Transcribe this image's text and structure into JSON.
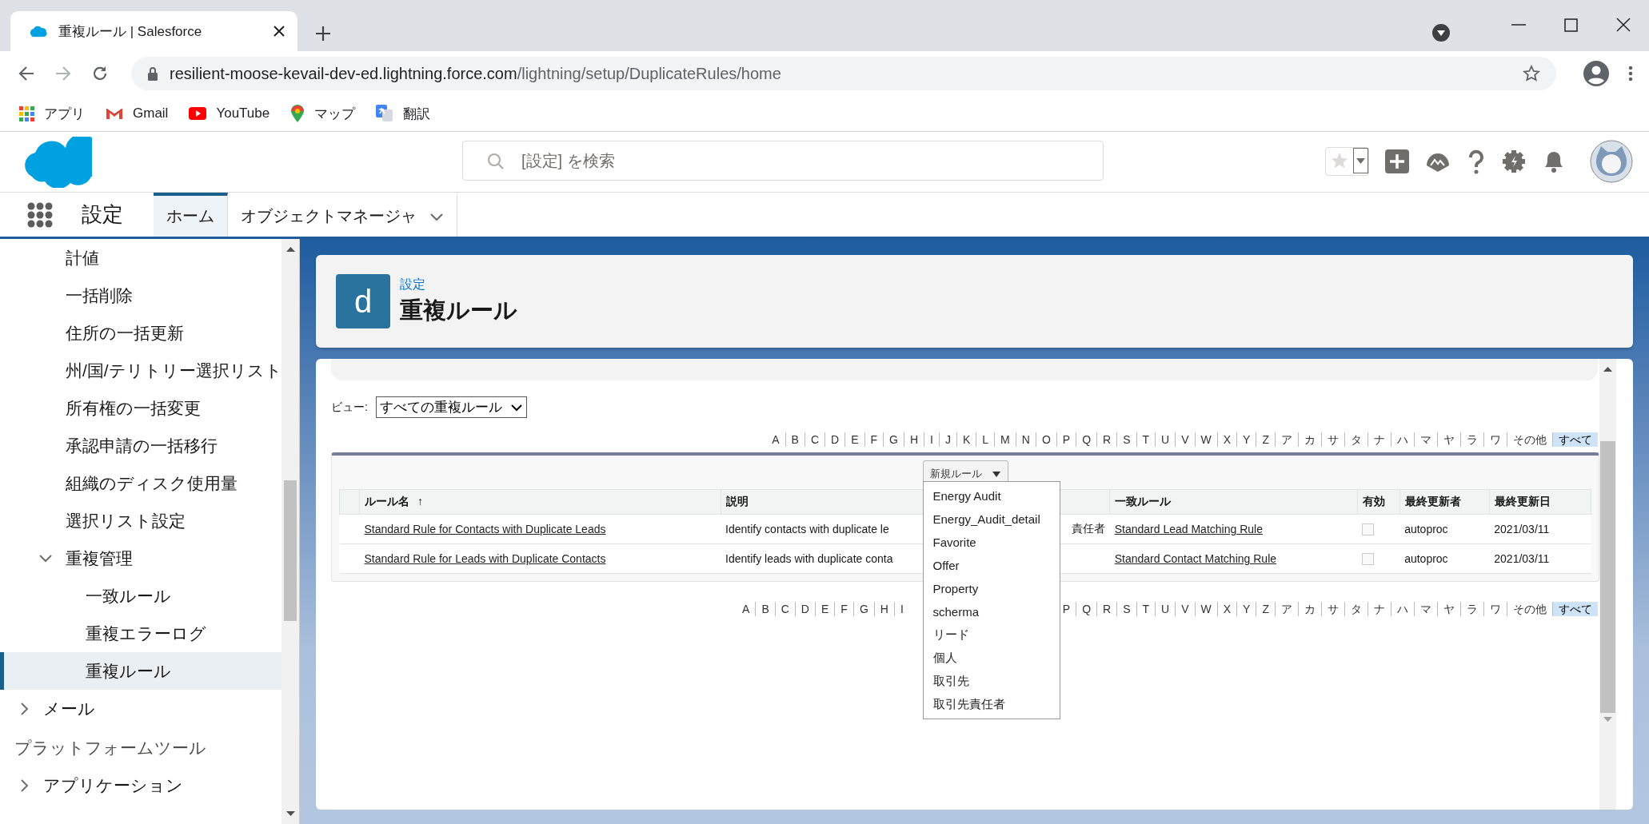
{
  "browser": {
    "tab_title": "重複ルール | Salesforce",
    "url_host": "resilient-moose-kevail-dev-ed.lightning.force.com",
    "url_path": "/lightning/setup/DuplicateRules/home",
    "bookmarks": [
      {
        "kind": "apps",
        "label": "アプリ"
      },
      {
        "kind": "gmail",
        "label": "Gmail"
      },
      {
        "kind": "youtube",
        "label": "YouTube"
      },
      {
        "kind": "maps",
        "label": "マップ"
      },
      {
        "kind": "translate",
        "label": "翻訳"
      }
    ]
  },
  "header": {
    "search_placeholder": "[設定] を検索"
  },
  "nav": {
    "app_name": "設定",
    "tabs": [
      {
        "label": "ホーム",
        "selected": true
      },
      {
        "label": "オブジェクトマネージャ",
        "selected": false
      }
    ]
  },
  "sidebar": {
    "items": [
      {
        "label": "計値",
        "selected": false
      },
      {
        "label": "一括削除",
        "selected": false
      },
      {
        "label": "住所の一括更新",
        "selected": false
      },
      {
        "label": "州/国/テリトリー選択リスト",
        "selected": false
      },
      {
        "label": "所有権の一括変更",
        "selected": false
      },
      {
        "label": "承認申請の一括移行",
        "selected": false
      },
      {
        "label": "組織のディスク使用量",
        "selected": false
      },
      {
        "label": "選択リスト設定",
        "selected": false
      },
      {
        "label": "重複管理",
        "selected": false,
        "expanded": true,
        "children": [
          {
            "label": "一致ルール",
            "selected": false
          },
          {
            "label": "重複エラーログ",
            "selected": false
          },
          {
            "label": "重複ルール",
            "selected": true
          }
        ]
      }
    ],
    "top_items": [
      {
        "label": "メール",
        "expanded": false
      }
    ],
    "section_title": "プラットフォームツール",
    "section_items": [
      {
        "label": "アプリケーション",
        "expanded": false
      }
    ]
  },
  "page_header": {
    "icon_letter": "d",
    "breadcrumb": "設定",
    "title": "重複ルール"
  },
  "view": {
    "label": "ビュー:",
    "value": "すべての重複ルール"
  },
  "alphabet_top": [
    {
      "label": "A",
      "selected": false
    },
    {
      "label": "B",
      "selected": false
    },
    {
      "label": "C",
      "selected": false
    },
    {
      "label": "D",
      "selected": false
    },
    {
      "label": "E",
      "selected": false
    },
    {
      "label": "F",
      "selected": false
    },
    {
      "label": "G",
      "selected": false
    },
    {
      "label": "H",
      "selected": false
    },
    {
      "label": "I",
      "selected": false
    },
    {
      "label": "J",
      "selected": false
    },
    {
      "label": "K",
      "selected": false
    },
    {
      "label": "L",
      "selected": false
    },
    {
      "label": "M",
      "selected": false
    },
    {
      "label": "N",
      "selected": false
    },
    {
      "label": "O",
      "selected": false
    },
    {
      "label": "P",
      "selected": false
    },
    {
      "label": "Q",
      "selected": false
    },
    {
      "label": "R",
      "selected": false
    },
    {
      "label": "S",
      "selected": false
    },
    {
      "label": "T",
      "selected": false
    },
    {
      "label": "U",
      "selected": false
    },
    {
      "label": "V",
      "selected": false
    },
    {
      "label": "W",
      "selected": false
    },
    {
      "label": "X",
      "selected": false
    },
    {
      "label": "Y",
      "selected": false
    },
    {
      "label": "Z",
      "selected": false
    },
    {
      "label": "ア",
      "selected": false
    },
    {
      "label": "カ",
      "selected": false
    },
    {
      "label": "サ",
      "selected": false
    },
    {
      "label": "タ",
      "selected": false
    },
    {
      "label": "ナ",
      "selected": false
    },
    {
      "label": "ハ",
      "selected": false
    },
    {
      "label": "マ",
      "selected": false
    },
    {
      "label": "ヤ",
      "selected": false
    },
    {
      "label": "ラ",
      "selected": false
    },
    {
      "label": "ワ",
      "selected": false
    },
    {
      "label": "その他",
      "selected": false
    },
    {
      "label": "すべて",
      "selected": true
    }
  ],
  "alphabet_bottom": {
    "before_menu": [
      {
        "label": "A",
        "selected": false
      },
      {
        "label": "B",
        "selected": false
      },
      {
        "label": "C",
        "selected": false
      },
      {
        "label": "D",
        "selected": false
      },
      {
        "label": "E",
        "selected": false
      },
      {
        "label": "F",
        "selected": false
      },
      {
        "label": "G",
        "selected": false
      },
      {
        "label": "H",
        "selected": false
      },
      {
        "label": "I",
        "selected": false
      }
    ],
    "after_menu": [
      {
        "label": "P",
        "selected": false
      },
      {
        "label": "Q",
        "selected": false
      },
      {
        "label": "R",
        "selected": false
      },
      {
        "label": "S",
        "selected": false
      },
      {
        "label": "T",
        "selected": false
      },
      {
        "label": "U",
        "selected": false
      },
      {
        "label": "V",
        "selected": false
      },
      {
        "label": "W",
        "selected": false
      },
      {
        "label": "X",
        "selected": false
      },
      {
        "label": "Y",
        "selected": false
      },
      {
        "label": "Z",
        "selected": false
      },
      {
        "label": "ア",
        "selected": false
      },
      {
        "label": "カ",
        "selected": false
      },
      {
        "label": "サ",
        "selected": false
      },
      {
        "label": "タ",
        "selected": false
      },
      {
        "label": "ナ",
        "selected": false
      },
      {
        "label": "ハ",
        "selected": false
      },
      {
        "label": "マ",
        "selected": false
      },
      {
        "label": "ヤ",
        "selected": false
      },
      {
        "label": "ラ",
        "selected": false
      },
      {
        "label": "ワ",
        "selected": false
      },
      {
        "label": "その他",
        "selected": false
      },
      {
        "label": "すべて",
        "selected": true
      }
    ]
  },
  "table": {
    "new_button": "新規ルール",
    "new_menu": [
      "Energy Audit",
      "Energy_Audit_detail",
      "Favorite",
      "Offer",
      "Property",
      "scherma",
      "リード",
      "個人",
      "取引先",
      "取引先責任者"
    ],
    "columns": [
      {
        "label": "ルール名",
        "sort_icon": "↑"
      },
      {
        "label": "説明"
      },
      {},
      {
        "label": "一致ルール"
      },
      {
        "label": "有効"
      },
      {
        "label": "最終更新者"
      },
      {
        "label": "最終更新日"
      }
    ],
    "rows": [
      {
        "name": "Standard Rule for Contacts with Duplicate Leads",
        "description": "Identify contacts with duplicate le",
        "column_3": "責任者",
        "matching_rule": "Standard Lead Matching Rule",
        "active": false,
        "modified_by": "autoproc",
        "modified_date": "2021/03/11"
      },
      {
        "name": "Standard Rule for Leads with Duplicate Contacts",
        "description": "Identify leads with duplicate conta",
        "matching_rule": "Standard Contact Matching Rule",
        "active": false,
        "modified_by": "autoproc",
        "modified_date": "2021/03/11"
      }
    ]
  }
}
